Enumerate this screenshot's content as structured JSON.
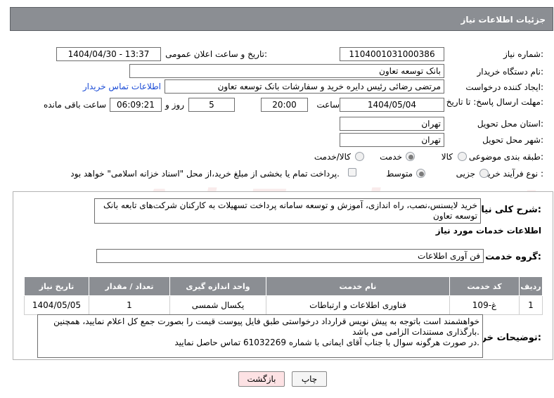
{
  "header": {
    "title": "جزئیات اطلاعات نیاز"
  },
  "labels": {
    "need_number": "شماره نیاز:",
    "announce_datetime": "تاریخ و ساعت اعلان عمومی:",
    "buyer_org": "نام دستگاه خریدار:",
    "requester": "ایجاد کننده درخواست:",
    "deadline": "مهلت ارسال پاسخ: تا تاریخ:",
    "time_word": "ساعت",
    "day_word": "روز و",
    "remaining": "ساعت باقی مانده",
    "province": "استان محل تحویل:",
    "city": "شهر محل تحویل:",
    "category": "طبقه بندی موضوعی:",
    "process_type": "نوع فرآیند خرید :",
    "general_desc": "شرح کلی نیاز:",
    "services_info": "اطلاعات خدمات مورد نیاز",
    "service_group": "گروه خدمت:",
    "buyer_notes": "توضیحات خریدار:"
  },
  "values": {
    "need_number": "1104001031000386",
    "announce_datetime": "1404/04/30 - 13:37",
    "buyer_org": "بانک توسعه تعاون",
    "requester": "مرتضی رضائی رئیس دایره خرید و سفارشات بانک توسعه تعاون",
    "contact_link": "اطلاعات تماس خریدار",
    "deadline_date": "1404/05/04",
    "deadline_time": "20:00",
    "days": "5",
    "remaining_time": "06:09:21",
    "province": "تهران",
    "city": "تهران",
    "general_desc": "خرید لایسنس،نصب، راه اندازی، آموزش و توسعه سامانه پرداخت تسهیلات به کارکنان شرکت‌های تابعه بانک توسعه تعاون",
    "service_group": "فن آوری اطلاعات"
  },
  "category_options": [
    {
      "label": "کالا",
      "selected": false
    },
    {
      "label": "خدمت",
      "selected": true
    },
    {
      "label": "کالا/خدمت",
      "selected": false
    }
  ],
  "process_options": [
    {
      "label": "جزیی",
      "selected": false
    },
    {
      "label": "متوسط",
      "selected": true
    }
  ],
  "payment_note": "پرداخت تمام یا بخشی از مبلغ خرید،از محل \"اسناد خزانه اسلامی\" خواهد بود.",
  "table": {
    "headers": [
      "ردیف",
      "کد خدمت",
      "نام خدمت",
      "واحد اندازه گیری",
      "تعداد / مقدار",
      "تاریخ نیاز"
    ],
    "rows": [
      [
        "1",
        "غ-109",
        "فناوری اطلاعات و ارتباطات",
        "یکسال شمسی",
        "1",
        "1404/05/05"
      ]
    ]
  },
  "notes": {
    "line1": "خواهشمند است باتوجه به پیش نویس قرارداد  درخواستی طبق فایل پیوست قیمت را بصورت جمع کل اعلام نمایید، همچنین",
    "line2": "بارگذاری مستندات الزامی می باشد.",
    "line3": "در صورت هرگونه سوال با جناب آقای ایمانی با شماره 61032269 تماس حاصل نمایید."
  },
  "buttons": {
    "print": "چاپ",
    "back": "بازگشت"
  },
  "watermark": "AriaTender.net"
}
